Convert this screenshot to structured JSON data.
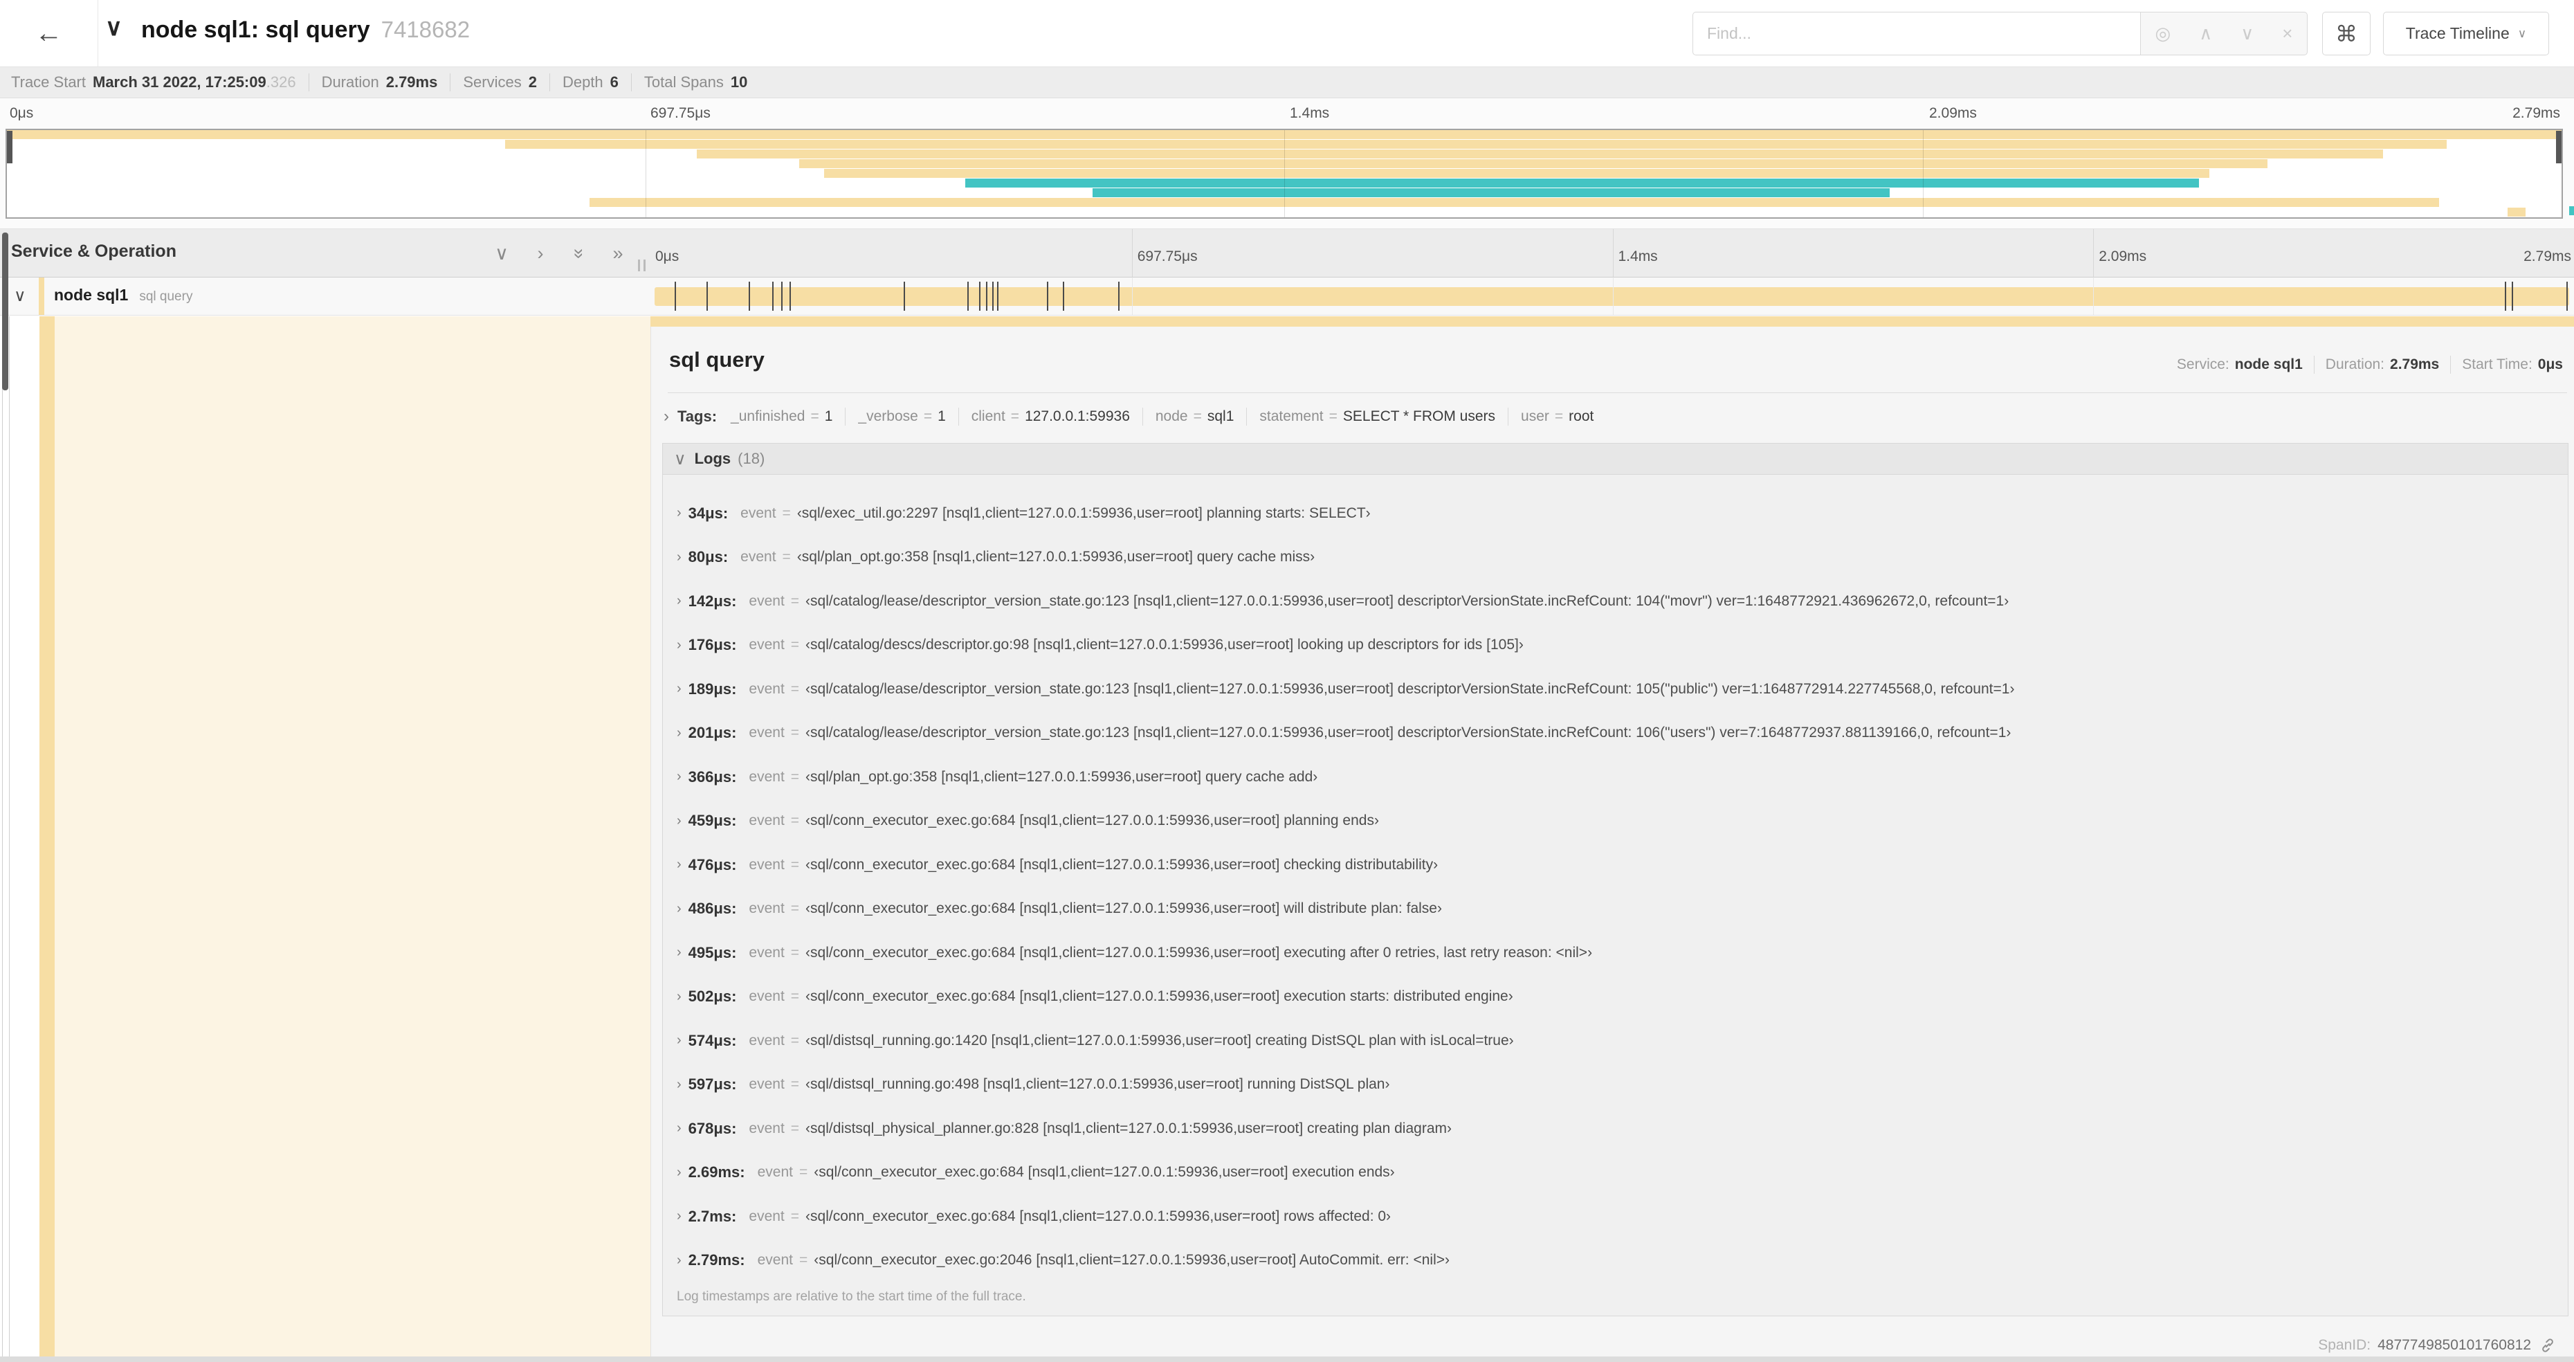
{
  "colors": {
    "span": "#f7dea4",
    "span_tint": "#fcf4e3",
    "teal": "#43c4c3"
  },
  "header": {
    "title": "node sql1: sql query",
    "trace_id": "7418682",
    "find_placeholder": "Find...",
    "view_selector_label": "Trace Timeline"
  },
  "icons": {
    "back": "←",
    "title_collapse": "∨",
    "crosshair": "◎",
    "find_prev": "∧",
    "find_next": "∨",
    "find_clear": "×",
    "command": "⌘",
    "dropdown": "∨",
    "collapse_one": "∨",
    "expand_one": "›",
    "collapse_all": "»",
    "expand_all": "»",
    "row_collapse": "∨",
    "section_expand": "›",
    "section_collapse": "∨"
  },
  "summary": {
    "items": [
      {
        "label": "Trace Start",
        "value": "March 31 2022, 17:25:09",
        "suffix": ".326"
      },
      {
        "label": "Duration",
        "value": "2.79ms",
        "suffix": ""
      },
      {
        "label": "Services",
        "value": "2",
        "suffix": ""
      },
      {
        "label": "Depth",
        "value": "6",
        "suffix": ""
      },
      {
        "label": "Total Spans",
        "value": "10",
        "suffix": ""
      }
    ]
  },
  "minimap": {
    "ticks": [
      "0μs",
      "697.75μs",
      "1.4ms",
      "2.09ms",
      "2.79ms"
    ],
    "spans": [
      {
        "start": 0.0,
        "end": 1.0,
        "color": "tan"
      },
      {
        "start": 0.195,
        "end": 0.955,
        "color": "tan"
      },
      {
        "start": 0.27,
        "end": 0.93,
        "color": "tan"
      },
      {
        "start": 0.31,
        "end": 0.885,
        "color": "tan"
      },
      {
        "start": 0.32,
        "end": 0.862,
        "color": "tan"
      },
      {
        "start": 0.375,
        "end": 0.858,
        "color": "teal"
      },
      {
        "start": 0.425,
        "end": 0.737,
        "color": "teal"
      },
      {
        "start": 0.228,
        "end": 0.952,
        "color": "tan"
      },
      {
        "start": 0.979,
        "end": 0.986,
        "color": "tan"
      }
    ]
  },
  "timeline": {
    "left_header": "Service & Operation",
    "ticks": [
      "0μs",
      "697.75μs",
      "1.4ms",
      "2.09ms",
      "2.79ms"
    ],
    "duration_us": 2790,
    "span": {
      "service": "node sql1",
      "operation": "sql query"
    },
    "log_markers_us": [
      34,
      80,
      142,
      176,
      189,
      201,
      366,
      459,
      476,
      486,
      495,
      502,
      574,
      597,
      678,
      2690,
      2700,
      2779
    ]
  },
  "detail": {
    "title": "sql query",
    "service_label": "Service:",
    "service": "node sql1",
    "duration_label": "Duration:",
    "duration": "2.79ms",
    "start_label": "Start Time:",
    "start": "0μs",
    "tags_label": "Tags:",
    "tags": [
      {
        "key": "_unfinished",
        "value": "1"
      },
      {
        "key": "_verbose",
        "value": "1"
      },
      {
        "key": "client",
        "value": "127.0.0.1:59936"
      },
      {
        "key": "node",
        "value": "sql1"
      },
      {
        "key": "statement",
        "value": "SELECT * FROM users"
      },
      {
        "key": "user",
        "value": "root"
      }
    ],
    "logs_label": "Logs",
    "logs_count": "(18)",
    "logs": [
      {
        "time": "34μs:",
        "key": "event",
        "value": "‹sql/exec_util.go:2297 [nsql1,client=127.0.0.1:59936,user=root] planning starts: SELECT›"
      },
      {
        "time": "80μs:",
        "key": "event",
        "value": "‹sql/plan_opt.go:358 [nsql1,client=127.0.0.1:59936,user=root] query cache miss›"
      },
      {
        "time": "142μs:",
        "key": "event",
        "value": "‹sql/catalog/lease/descriptor_version_state.go:123 [nsql1,client=127.0.0.1:59936,user=root] descriptorVersionState.incRefCount: 104(\"movr\") ver=1:1648772921.436962672,0, refcount=1›"
      },
      {
        "time": "176μs:",
        "key": "event",
        "value": "‹sql/catalog/descs/descriptor.go:98 [nsql1,client=127.0.0.1:59936,user=root] looking up descriptors for ids [105]›"
      },
      {
        "time": "189μs:",
        "key": "event",
        "value": "‹sql/catalog/lease/descriptor_version_state.go:123 [nsql1,client=127.0.0.1:59936,user=root] descriptorVersionState.incRefCount: 105(\"public\") ver=1:1648772914.227745568,0, refcount=1›"
      },
      {
        "time": "201μs:",
        "key": "event",
        "value": "‹sql/catalog/lease/descriptor_version_state.go:123 [nsql1,client=127.0.0.1:59936,user=root] descriptorVersionState.incRefCount: 106(\"users\") ver=7:1648772937.881139166,0, refcount=1›"
      },
      {
        "time": "366μs:",
        "key": "event",
        "value": "‹sql/plan_opt.go:358 [nsql1,client=127.0.0.1:59936,user=root] query cache add›"
      },
      {
        "time": "459μs:",
        "key": "event",
        "value": "‹sql/conn_executor_exec.go:684 [nsql1,client=127.0.0.1:59936,user=root] planning ends›"
      },
      {
        "time": "476μs:",
        "key": "event",
        "value": "‹sql/conn_executor_exec.go:684 [nsql1,client=127.0.0.1:59936,user=root] checking distributability›"
      },
      {
        "time": "486μs:",
        "key": "event",
        "value": "‹sql/conn_executor_exec.go:684 [nsql1,client=127.0.0.1:59936,user=root] will distribute plan: false›"
      },
      {
        "time": "495μs:",
        "key": "event",
        "value": "‹sql/conn_executor_exec.go:684 [nsql1,client=127.0.0.1:59936,user=root] executing after 0 retries, last retry reason: <nil>›"
      },
      {
        "time": "502μs:",
        "key": "event",
        "value": "‹sql/conn_executor_exec.go:684 [nsql1,client=127.0.0.1:59936,user=root] execution starts: distributed engine›"
      },
      {
        "time": "574μs:",
        "key": "event",
        "value": "‹sql/distsql_running.go:1420 [nsql1,client=127.0.0.1:59936,user=root] creating DistSQL plan with isLocal=true›"
      },
      {
        "time": "597μs:",
        "key": "event",
        "value": "‹sql/distsql_running.go:498 [nsql1,client=127.0.0.1:59936,user=root] running DistSQL plan›"
      },
      {
        "time": "678μs:",
        "key": "event",
        "value": "‹sql/distsql_physical_planner.go:828 [nsql1,client=127.0.0.1:59936,user=root] creating plan diagram›"
      },
      {
        "time": "2.69ms:",
        "key": "event",
        "value": "‹sql/conn_executor_exec.go:684 [nsql1,client=127.0.0.1:59936,user=root] execution ends›"
      },
      {
        "time": "2.7ms:",
        "key": "event",
        "value": "‹sql/conn_executor_exec.go:684 [nsql1,client=127.0.0.1:59936,user=root] rows affected: 0›"
      },
      {
        "time": "2.79ms:",
        "key": "event",
        "value": "‹sql/conn_executor_exec.go:2046 [nsql1,client=127.0.0.1:59936,user=root] AutoCommit. err: <nil>›"
      }
    ],
    "logs_note": "Log timestamps are relative to the start time of the full trace.",
    "spanid_label": "SpanID:",
    "spanid": "4877749850101760812"
  }
}
